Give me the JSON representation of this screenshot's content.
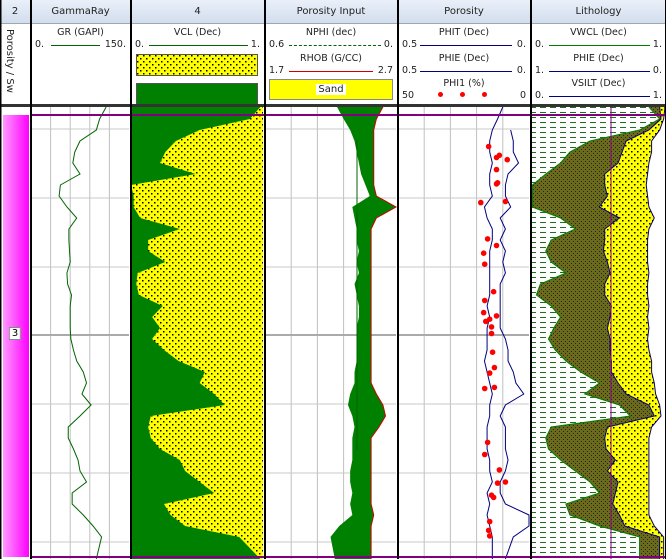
{
  "header": {
    "columns": [
      "2",
      "GammaRay",
      "4",
      "Porosity Input",
      "Porosity",
      "Lithology"
    ]
  },
  "legend": {
    "zone_label": "Porosity / Sw",
    "gammaray": {
      "curve": "GR (GAPI)",
      "min": "0.",
      "max": "150.",
      "color": "#006400"
    },
    "vcl": {
      "curve": "VCL (Dec)",
      "min": "0.",
      "max": "1.",
      "color": "#006400",
      "sand_fill": "#ffff00",
      "shale_fill": "#008000"
    },
    "porosity_input": {
      "nphi": {
        "curve": "NPHI (dec)",
        "min": "0.6",
        "max": "0.",
        "color": "#006400"
      },
      "rhob": {
        "curve": "RHOB (G/CC)",
        "min": "1.7",
        "max": "2.7",
        "color": "#cc0000"
      },
      "fill_label": "Sand"
    },
    "porosity": {
      "phit": {
        "curve": "PHIT (Dec)",
        "min": "0.5",
        "max": "0.",
        "color": "#000080"
      },
      "phie": {
        "curve": "PHIE (Dec)",
        "min": "0.5",
        "max": "0.",
        "color": "#000080"
      },
      "phi1": {
        "curve": "PHI1 (%)",
        "min": "50",
        "max": "0",
        "color": "#ff0000"
      }
    },
    "lithology": {
      "vwcl": {
        "curve": "VWCL (Dec)",
        "min": "0.",
        "max": "1.",
        "color": "#008000"
      },
      "phie": {
        "curve": "PHIE (Dec)",
        "min": "1.",
        "max": "0.",
        "color": "#000080"
      },
      "vsilt": {
        "curve": "VSILT (Dec)",
        "min": "0.",
        "max": "1.",
        "color": "#000080"
      }
    }
  },
  "zone": {
    "label": "3",
    "color": "#ff33ff"
  },
  "curves": {
    "gr": [
      115,
      105,
      100,
      75,
      67,
      64,
      75,
      45,
      43,
      55,
      70,
      58,
      58,
      59,
      60,
      55,
      56,
      62,
      60,
      60,
      60,
      61,
      65,
      70,
      80,
      85,
      78,
      92,
      75,
      57,
      57,
      65,
      72,
      75,
      85,
      63,
      63,
      80,
      95,
      108,
      100
    ],
    "vcl": [
      0.98,
      0.9,
      0.52,
      0.34,
      0.26,
      0.22,
      0.49,
      0,
      0.02,
      0.02,
      0.07,
      0.37,
      0.13,
      0.13,
      0.26,
      0.05,
      0.04,
      0.06,
      0.24,
      0.16,
      0.22,
      0.16,
      0.25,
      0.36,
      0.56,
      0.52,
      0.63,
      0.71,
      0.15,
      0.13,
      0.15,
      0.22,
      0.37,
      0.41,
      0.52,
      0.63,
      0.25,
      0.3,
      0.41,
      0.82,
      0.98
    ],
    "nphi": [
      0.27,
      0.24,
      0.21,
      0.19,
      0.18,
      0.17,
      0.16,
      0.14,
      0.12,
      0.2,
      0.19,
      0.18,
      0.18,
      0.17,
      0.18,
      0.17,
      0.19,
      0.18,
      0.17,
      0.17,
      0.18,
      0.18,
      0.18,
      0.18,
      0.19,
      0.19,
      0.21,
      0.22,
      0.2,
      0.19,
      0.2,
      0.2,
      0.2,
      0.21,
      0.21,
      0.2,
      0.21,
      0.2,
      0.26,
      0.3,
      0.28
    ],
    "rhob": [
      2.6,
      2.55,
      2.53,
      2.53,
      2.53,
      2.53,
      2.53,
      2.53,
      2.55,
      2.7,
      2.55,
      2.51,
      2.51,
      2.51,
      2.51,
      2.51,
      2.51,
      2.51,
      2.51,
      2.51,
      2.51,
      2.51,
      2.51,
      2.51,
      2.51,
      2.51,
      2.55,
      2.6,
      2.62,
      2.57,
      2.51,
      2.51,
      2.51,
      2.51,
      2.51,
      2.51,
      2.51,
      2.53,
      2.51,
      2.51,
      2.51
    ],
    "phie": [
      0.1,
      0.12,
      0.14,
      0.15,
      0.15,
      0.14,
      0.15,
      0.15,
      0.14,
      0.17,
      0.16,
      0.14,
      0.14,
      0.15,
      0.15,
      0.15,
      0.15,
      0.15,
      0.16,
      0.15,
      0.16,
      0.16,
      0.16,
      0.17,
      0.16,
      0.15,
      0.14,
      0.15,
      0.15,
      0.16,
      0.16,
      0.16,
      0.15,
      0.15,
      0.14,
      0.16,
      0.15,
      0.16,
      0.15,
      0.14,
      0.14
    ],
    "phit": [
      null,
      null,
      0.07,
      0.06,
      0.06,
      0.04,
      0.08,
      0.09,
      0.09,
      0.07,
      0.11,
      0.09,
      0.11,
      0.09,
      0.1,
      0.09,
      0.11,
      0.11,
      0.11,
      0.11,
      0.11,
      0.09,
      0.08,
      0.08,
      0.06,
      0.05,
      0.02,
      0.09,
      0.11,
      0.09,
      0.09,
      0.09,
      0.08,
      0.09,
      0.11,
      0.11,
      0.09,
      0.0,
      0.0,
      0.06,
      0.09
    ],
    "phi1_points": [
      [
        3.5,
        15.4
      ],
      [
        4.5,
        12.4
      ],
      [
        4.3,
        11.3
      ],
      [
        4.7,
        8.3
      ],
      [
        5.6,
        12.4
      ],
      [
        6.8,
        12.0
      ],
      [
        6.9,
        12.4
      ],
      [
        8.6,
        18.4
      ],
      [
        8.5,
        9.0
      ],
      [
        11.9,
        15.8
      ],
      [
        12.5,
        12.4
      ],
      [
        13.2,
        17.3
      ],
      [
        14.2,
        16.9
      ],
      [
        16.7,
        13.5
      ],
      [
        17.5,
        16.9
      ],
      [
        18.6,
        17.3
      ],
      [
        18.9,
        12.4
      ],
      [
        19.4,
        16.5
      ],
      [
        19.2,
        15.0
      ],
      [
        19.9,
        14.3
      ],
      [
        20.5,
        14.3
      ],
      [
        22.2,
        13.9
      ],
      [
        23.6,
        13.2
      ],
      [
        24.1,
        15.0
      ],
      [
        25.5,
        16.9
      ],
      [
        25.4,
        13.2
      ],
      [
        30.4,
        15.8
      ],
      [
        31.5,
        16.9
      ],
      [
        32.9,
        11.3
      ],
      [
        34.0,
        9.0
      ],
      [
        34.1,
        12.0
      ],
      [
        35.2,
        14.3
      ],
      [
        35.4,
        13.5
      ],
      [
        37.6,
        15.0
      ],
      [
        38.4,
        15.4
      ],
      [
        38.9,
        15.0
      ]
    ],
    "lith_vwcl": [
      0.88,
      0.96,
      0.81,
      0.44,
      0.29,
      0.22,
      0.11,
      0.01,
      0.01,
      0.01,
      0.22,
      0.33,
      0.15,
      0.11,
      0.15,
      0.26,
      0.07,
      0.04,
      0.15,
      0.22,
      0.17,
      0.13,
      0.18,
      0.26,
      0.37,
      0.51,
      0.4,
      0.66,
      0.74,
      0.15,
      0.11,
      0.13,
      0.22,
      0.33,
      0.44,
      0.51,
      0.26,
      0.29,
      0.51,
      0.81,
      0.81
    ],
    "lith_vsilt": [
      0.96,
      0.97,
      0.88,
      0.71,
      0.68,
      0.65,
      0.55,
      0.55,
      0.57,
      0.51,
      0.66,
      0.55,
      0.55,
      0.54,
      0.57,
      0.59,
      0.55,
      0.55,
      0.6,
      0.59,
      0.57,
      0.59,
      0.59,
      0.6,
      0.6,
      0.65,
      0.71,
      0.88,
      0.92,
      0.57,
      0.55,
      0.56,
      0.63,
      0.57,
      0.65,
      0.63,
      0.61,
      0.66,
      0.7,
      0.96,
      0.96
    ],
    "lith_phie": [
      0,
      0.01,
      0.04,
      0.1,
      0.1,
      0.12,
      0.13,
      0.14,
      0.13,
      0.12,
      0.08,
      0.12,
      0.13,
      0.13,
      0.13,
      0.12,
      0.13,
      0.13,
      0.12,
      0.13,
      0.12,
      0.13,
      0.12,
      0.1,
      0.1,
      0.08,
      0.07,
      0.04,
      0.03,
      0.1,
      0.12,
      0.12,
      0.12,
      0.12,
      0.12,
      0.12,
      0.12,
      0.12,
      0.08,
      0.01,
      0.01
    ]
  },
  "colors": {
    "silt_fill": "#6b6b1a",
    "shale_dash": "#207020",
    "zone_boundary": "#800080"
  }
}
